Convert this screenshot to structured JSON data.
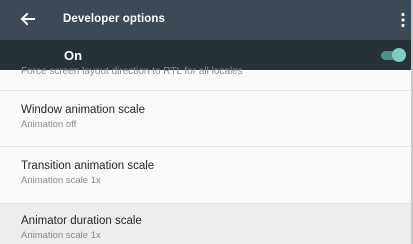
{
  "appbar": {
    "title": "Developer options",
    "back_icon": "arrow-back-icon",
    "overflow_icon": "more-vert-icon"
  },
  "master_switch": {
    "label": "On",
    "checked": true
  },
  "partial_item_summary": "Force screen layout direction to RTL for all locales",
  "items": [
    {
      "title": "Window animation scale",
      "summary": "Animation off"
    },
    {
      "title": "Transition animation scale",
      "summary": "Animation scale 1x"
    },
    {
      "title": "Animator duration scale",
      "summary": "Animation scale 1x"
    }
  ],
  "colors": {
    "appbar": "#3b4a55",
    "switch_bar": "#263238",
    "accent": "#80cbc4",
    "background": "#fafafa"
  }
}
